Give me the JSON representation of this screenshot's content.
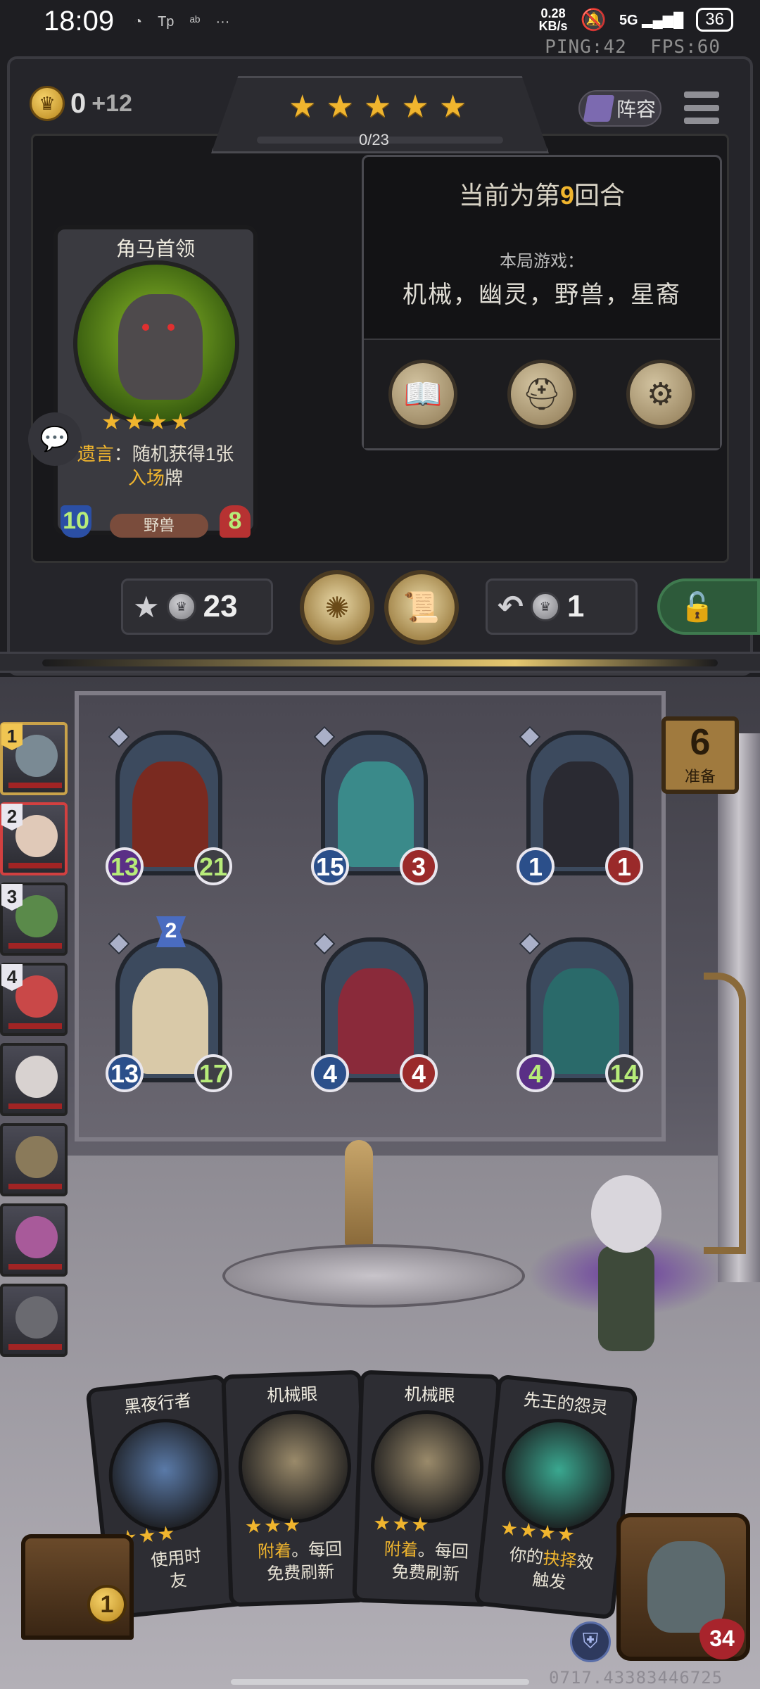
{
  "status_bar": {
    "time": "18:09",
    "app_icons": [
      "◔",
      "Tp",
      "ᵃᵇ",
      "···"
    ],
    "net_speed_top": "0.28",
    "net_speed_unit": "KB/s",
    "signal": "5G",
    "battery": "36",
    "ping": "PING:42",
    "fps": "FPS:60"
  },
  "header": {
    "gold": "0",
    "gold_income": "+12",
    "tavern_stars": 5,
    "xp": "0/23",
    "lineup_label": "阵容"
  },
  "info_panel": {
    "round_prefix": "当前为第",
    "round_number": "9",
    "round_suffix": "回合",
    "tribes_title": "本局游戏：",
    "tribes": "机械，幽灵，野兽，星裔",
    "buttons": [
      "book-icon",
      "hat-icon",
      "gear-icon"
    ]
  },
  "featured_card": {
    "name": "角马首领",
    "stars": 4,
    "desc_keyword": "遗言",
    "desc_mid": "：随机获得1张",
    "desc_keyword2": "入场",
    "desc_end": "牌",
    "attack": "10",
    "health": "8",
    "tribe": "野兽"
  },
  "actions": {
    "upgrade_cost": "23",
    "refresh_cost": "1"
  },
  "battle": {
    "ready_count": "6",
    "ready_label": "准备",
    "roster": [
      {
        "rank": "1",
        "color": "#7a8a94"
      },
      {
        "rank": "2",
        "color": "#e0c9b8"
      },
      {
        "rank": "3",
        "color": "#5a8a4a"
      },
      {
        "rank": "4",
        "color": "#c94848"
      },
      {
        "rank": "",
        "color": "#d8d2d0"
      },
      {
        "rank": "",
        "color": "#8a7a5a"
      },
      {
        "rank": "",
        "color": "#a85a9a"
      },
      {
        "rank": "",
        "color": "#6a6a70"
      }
    ],
    "units": [
      {
        "attack": "13",
        "health": "21",
        "color": "#7a2a20",
        "atk_buff": true,
        "hp_buff": true
      },
      {
        "attack": "15",
        "health": "3",
        "color": "#3a8a8a",
        "atk_buff": false,
        "hp_buff": false
      },
      {
        "attack": "1",
        "health": "1",
        "color": "#2a2a32",
        "atk_buff": false,
        "hp_buff": false
      },
      {
        "attack": "13",
        "health": "17",
        "color": "#d9c9a8",
        "atk_buff": false,
        "hp_buff": true,
        "tier": "2"
      },
      {
        "attack": "4",
        "health": "4",
        "color": "#8a2a3a",
        "atk_buff": false,
        "hp_buff": false
      },
      {
        "attack": "4",
        "health": "14",
        "color": "#2a6a6a",
        "atk_buff": true,
        "hp_buff": true
      }
    ]
  },
  "hand": [
    {
      "name": "黑夜行者",
      "stars": 3,
      "desc_a": "",
      "desc_kw": "",
      "desc_b": "使用时",
      "desc_c": "友",
      "art": "#5a7aa8"
    },
    {
      "name": "机械眼",
      "stars": 3,
      "desc_a": "",
      "desc_kw": "附着",
      "desc_b": "。每回",
      "desc_c": "免费刷新",
      "art": "#9a8a6a"
    },
    {
      "name": "机械眼",
      "stars": 3,
      "desc_a": "",
      "desc_kw": "附着",
      "desc_b": "。每回",
      "desc_c": "免费刷新",
      "art": "#9a8a6a"
    },
    {
      "name": "先王的怨灵",
      "stars": 4,
      "desc_a": "你的",
      "desc_kw": "抉择",
      "desc_b": "效",
      "desc_c": "触发",
      "art": "#3aa890"
    }
  ],
  "bottom": {
    "chest_count": "1",
    "player_health": "34",
    "build_id": "0717.43383446725"
  }
}
